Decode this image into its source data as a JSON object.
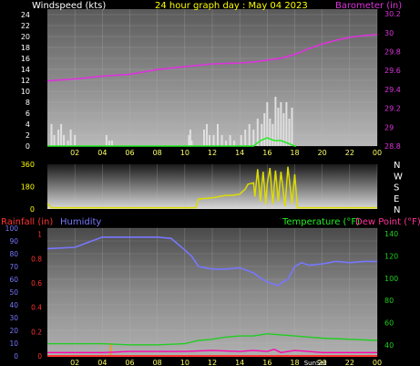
{
  "header": {
    "left_label": "Windspeed (kts)",
    "title": "24 hour graph day : May 04 2023",
    "right_label": "Barometer (in)"
  },
  "legends": {
    "rainfall": "Rainfall (in)",
    "humidity": "Humidity",
    "temperature": "Temperature (°F)",
    "dewpoint": "Dew Point (°F)"
  },
  "colors": {
    "wind": "#e0e0e0",
    "gust": "#22ee22",
    "barometer": "#dd33dd",
    "direction": "#dddd00",
    "humidity": "#7777ff",
    "temperature": "#22cc22",
    "dewpoint": "#ff00aa",
    "rainfall": "#ff3333",
    "left_axis": "#ffffff",
    "right_axis_top": "#dd33dd",
    "right_axis_bottom": "#22cc22",
    "time_axis": "#ffff66",
    "dir_axis": "#ffff00"
  },
  "chart_data": [
    {
      "type": "line",
      "name": "wind-barometer",
      "x_ticks": [
        "02",
        "04",
        "06",
        "08",
        "10",
        "12",
        "14",
        "16",
        "18",
        "20",
        "22",
        "00"
      ],
      "y_left_ticks": [
        0,
        2,
        4,
        6,
        8,
        10,
        12,
        14,
        16,
        18,
        20,
        22,
        24
      ],
      "y_right_ticks": [
        "28.8",
        "29",
        "29.2",
        "29.4",
        "29.6",
        "29.8",
        "30",
        "30.2"
      ],
      "y_left_lim": [
        0,
        25
      ],
      "y_right_lim": [
        28.8,
        30.25
      ],
      "series": [
        {
          "name": "Windspeed (kts)",
          "style": "bars",
          "x": [
            0.3,
            0.5,
            0.8,
            1.0,
            1.2,
            1.5,
            1.7,
            2.0,
            4.3,
            4.5,
            4.7,
            10.3,
            10.4,
            10.5,
            11.4,
            11.6,
            11.8,
            12.1,
            12.4,
            12.7,
            13.0,
            13.3,
            13.6,
            14.1,
            14.4,
            14.7,
            15.0,
            15.3,
            15.6,
            15.8,
            16.0,
            16.2,
            16.4,
            16.6,
            16.8,
            17.0,
            17.2,
            17.4,
            17.6,
            17.8
          ],
          "y": [
            4,
            2,
            3,
            4,
            2,
            1,
            3,
            2,
            2,
            1,
            1,
            2,
            3,
            1,
            3,
            4,
            2,
            2,
            4,
            2,
            1,
            2,
            1,
            2,
            3,
            4,
            3,
            5,
            4,
            6,
            8,
            5,
            4,
            9,
            7,
            8,
            6,
            8,
            5,
            7
          ]
        },
        {
          "name": "Gust",
          "style": "line",
          "x": [
            0,
            2,
            4,
            6,
            8,
            10,
            12,
            14,
            15,
            15.5,
            16,
            16.5,
            17,
            17.5,
            18,
            18.1
          ],
          "y": [
            0,
            0,
            0,
            0,
            0,
            0,
            0,
            0,
            0,
            1,
            1.5,
            1,
            1,
            0.5,
            0,
            0
          ]
        },
        {
          "name": "Barometer (in)",
          "axis": "right",
          "x": [
            0,
            2,
            4,
            6,
            8,
            10,
            12,
            14,
            15,
            16,
            17,
            18,
            19,
            20,
            21,
            22,
            23,
            24
          ],
          "y": [
            29.49,
            29.51,
            29.54,
            29.56,
            29.61,
            29.64,
            29.67,
            29.68,
            29.69,
            29.71,
            29.73,
            29.77,
            29.83,
            29.88,
            29.92,
            29.95,
            29.97,
            29.98
          ]
        }
      ]
    },
    {
      "type": "line",
      "name": "wind-direction",
      "y_labels_left": [
        "360",
        "180",
        "0"
      ],
      "y_labels_right": [
        "N",
        "W",
        "S",
        "E",
        "N"
      ],
      "y_lim": [
        0,
        360
      ],
      "series": [
        {
          "name": "Wind direction",
          "x": [
            0,
            0.3,
            1,
            3,
            6,
            9,
            10.8,
            11,
            12,
            12.5,
            13,
            13.5,
            14,
            14.4,
            14.6,
            15,
            15.1,
            15.3,
            15.5,
            15.7,
            15.9,
            16,
            16.2,
            16.4,
            16.6,
            16.8,
            17,
            17.3,
            17.5,
            17.8,
            18,
            18.2,
            20,
            22,
            24
          ],
          "y": [
            45,
            10,
            10,
            10,
            10,
            10,
            10,
            80,
            90,
            100,
            110,
            110,
            120,
            160,
            200,
            210,
            100,
            320,
            60,
            300,
            40,
            200,
            330,
            40,
            310,
            60,
            300,
            20,
            340,
            40,
            280,
            10,
            10,
            10,
            10
          ]
        }
      ]
    },
    {
      "type": "line",
      "name": "humidity-temperature",
      "x_ticks": [
        "02",
        "04",
        "06",
        "08",
        "10",
        "12",
        "14",
        "16",
        "18",
        "20",
        "22",
        "00"
      ],
      "rainfall_ticks": [
        "0",
        "0.2",
        "0.4",
        "0.6",
        "0.8",
        "1"
      ],
      "humidity_ticks": [
        0,
        10,
        20,
        30,
        40,
        50,
        60,
        70,
        80,
        90,
        100
      ],
      "temperature_ticks": [
        40,
        60,
        80,
        100,
        120,
        140
      ],
      "humidity_lim": [
        0,
        100
      ],
      "temperature_lim": [
        30,
        145
      ],
      "rainfall_lim": [
        0,
        1.05
      ],
      "sun_labels": [
        "SunSet"
      ],
      "series": [
        {
          "name": "Humidity",
          "x": [
            0,
            2,
            3,
            4,
            6,
            8,
            9,
            10,
            10.5,
            11,
            12,
            13,
            14,
            15,
            15.5,
            16,
            16.5,
            16.8,
            17,
            17.5,
            18,
            18.5,
            19,
            20,
            21,
            22,
            23,
            24
          ],
          "y": [
            84,
            85,
            89,
            93,
            93,
            93,
            92,
            83,
            78,
            70,
            68,
            68,
            69,
            65,
            61,
            58,
            56,
            55,
            57,
            60,
            70,
            73,
            71,
            72,
            74,
            73,
            74,
            74
          ]
        },
        {
          "name": "Temperature (°F)",
          "x": [
            0,
            2,
            4,
            6,
            8,
            10,
            11,
            12,
            13,
            14,
            15,
            16,
            17,
            18,
            19,
            20,
            22,
            24
          ],
          "y": [
            41,
            41,
            41,
            40,
            40,
            41,
            44,
            45,
            47,
            48,
            48,
            50,
            49,
            48,
            47,
            46,
            45,
            44
          ]
        },
        {
          "name": "Dew Point (°F)",
          "x": [
            0,
            2,
            4,
            6,
            8,
            10,
            12,
            14,
            15,
            16,
            16.5,
            17,
            18,
            19,
            20,
            22,
            24
          ],
          "y": [
            33,
            33,
            33,
            34,
            34,
            34,
            35,
            34,
            35,
            34,
            36,
            33,
            35,
            34,
            33,
            33,
            33
          ]
        },
        {
          "name": "Rainfall (in)",
          "x": [
            0,
            4,
            4.1,
            12,
            24
          ],
          "y": [
            0,
            0,
            0,
            0,
            0
          ]
        }
      ]
    }
  ]
}
